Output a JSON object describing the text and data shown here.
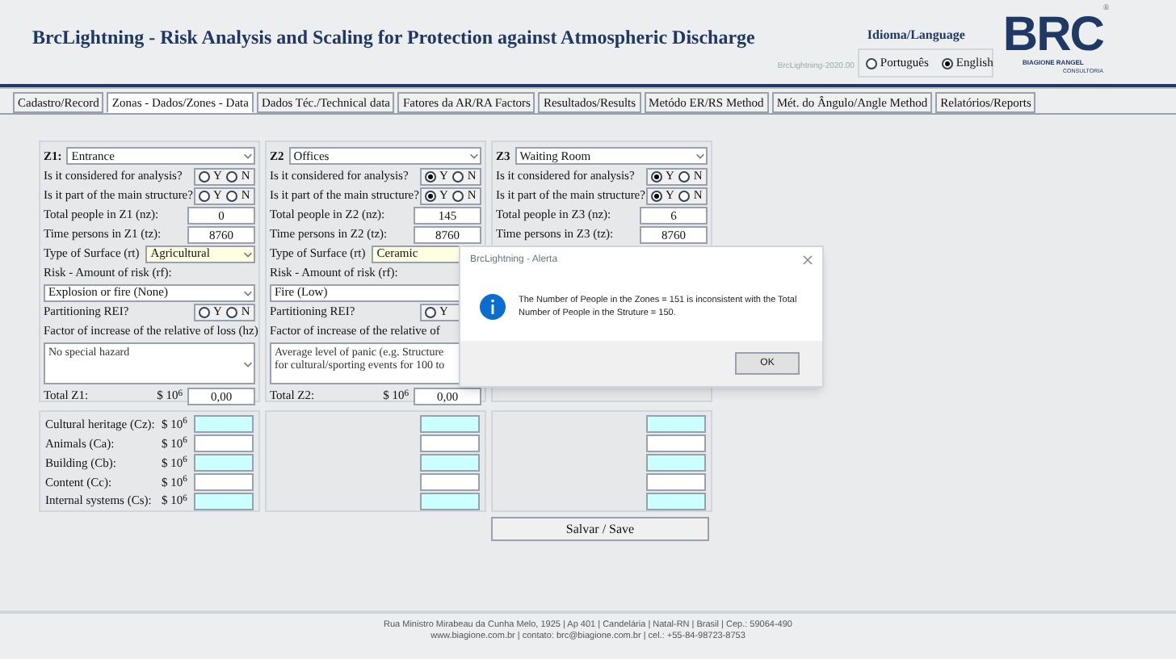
{
  "header": {
    "title": "BrcLightning - Risk Analysis and Scaling for Protection against Atmospheric Discharge",
    "version": "BrcLightning-2020.00",
    "language": {
      "label": "Idioma/Language",
      "options": [
        {
          "label": "Português",
          "selected": false
        },
        {
          "label": "English",
          "selected": true
        }
      ]
    },
    "logo": {
      "letters": "BRC",
      "name": "BIAGIONE RANGEL",
      "sub": "CONSULTORIA",
      "mark": "®"
    }
  },
  "tabs": [
    {
      "label": "Cadastro/Record",
      "selected": false
    },
    {
      "label": "Zonas - Dados/Zones - Data",
      "selected": true
    },
    {
      "label": "Dados Téc./Technical data",
      "selected": false
    },
    {
      "label": "Fatores da AR/RA Factors",
      "selected": false
    },
    {
      "label": "Resultados/Results",
      "selected": false
    },
    {
      "label": "Metódo ER/RS Method",
      "selected": false
    },
    {
      "label": "Mét. do Ângulo/Angle Method",
      "selected": false
    },
    {
      "label": "Relatórios/Reports",
      "selected": false
    }
  ],
  "zones": [
    {
      "code": "Z1:",
      "name": "Entrance",
      "rows": [
        {
          "kind": "yn",
          "label": "Is it considered for analysis?",
          "options": [
            {
              "label": "Y",
              "selected": false
            },
            {
              "label": "N",
              "selected": false
            }
          ]
        },
        {
          "kind": "yn",
          "label": "Is it part of the main structure?",
          "options": [
            {
              "label": "Y",
              "selected": false
            },
            {
              "label": "N",
              "selected": false
            }
          ]
        },
        {
          "kind": "input",
          "label": "Total people in Z1 (nz):",
          "value": "0"
        },
        {
          "kind": "input",
          "label": "Time persons in Z1 (tz):",
          "value": "8760"
        },
        {
          "kind": "inline_select",
          "label": "Type of Surface (rt)",
          "value": "Agricultural"
        },
        {
          "kind": "heading",
          "label": "Risk - Amount of risk (rf):"
        },
        {
          "kind": "select",
          "value": "Explosion or fire (None)"
        },
        {
          "kind": "yn",
          "label": "Partitioning REI?",
          "options": [
            {
              "label": "Y",
              "selected": false
            },
            {
              "label": "N",
              "selected": false
            }
          ]
        },
        {
          "kind": "heading",
          "label": "Factor of increase of the relative of loss (hz)"
        },
        {
          "kind": "textarea",
          "value": "No special hazard"
        },
        {
          "kind": "total",
          "label": "Total Z1:",
          "unit": "$ 10$^{6}$",
          "value": "0,00"
        }
      ]
    },
    {
      "code": "Z2",
      "name": "Offices",
      "rows": [
        {
          "kind": "yn",
          "label": "Is it considered for analysis?",
          "options": [
            {
              "label": "Y",
              "selected": true
            },
            {
              "label": "N",
              "selected": false
            }
          ]
        },
        {
          "kind": "yn",
          "label": "Is it part of the main structure?",
          "options": [
            {
              "label": "Y",
              "selected": true
            },
            {
              "label": "N",
              "selected": false
            }
          ]
        },
        {
          "kind": "input",
          "label": "Total people in Z2 (nz):",
          "value": "145"
        },
        {
          "kind": "input",
          "label": "Time persons in Z2 (tz):",
          "value": "8760"
        },
        {
          "kind": "inline_select",
          "label": "Type of Surface (rt)",
          "value": "Ceramic",
          "arrow": false
        },
        {
          "kind": "heading",
          "label": "Risk - Amount of risk (rf):"
        },
        {
          "kind": "select",
          "value": "Fire (Low)",
          "arrow": false
        },
        {
          "kind": "yn",
          "label": "Partitioning REI?",
          "options": [
            {
              "label": "Y",
              "selected": false
            }
          ]
        },
        {
          "kind": "heading",
          "label": "Factor of increase of the relative of"
        },
        {
          "kind": "textarea",
          "value": "Average level of panic (e.g. Structure for cultural/sporting events for 100 to",
          "arrow": false
        },
        {
          "kind": "total",
          "label": "Total Z2:",
          "unit": "$ 10$^{6}$",
          "value": "0,00"
        }
      ]
    },
    {
      "code": "Z3",
      "name": "Waiting Room",
      "rows": [
        {
          "kind": "yn",
          "label": "Is it considered for analysis?",
          "options": [
            {
              "label": "Y",
              "selected": true
            },
            {
              "label": "N",
              "selected": false
            }
          ]
        },
        {
          "kind": "yn",
          "label": "Is it part of the main structure?",
          "options": [
            {
              "label": "Y",
              "selected": true
            },
            {
              "label": "N",
              "selected": false
            }
          ]
        },
        {
          "kind": "input",
          "label": "Total people in Z3 (nz):",
          "value": "6"
        },
        {
          "kind": "input",
          "label": "Time persons in Z3 (tz):",
          "value": "8760"
        }
      ]
    }
  ],
  "costs": [
    {
      "label": "Cultural heritage (Cz):",
      "unit": "$ 10$^{6}$",
      "color": "#ccffff"
    },
    {
      "label": "Animals (Ca):",
      "unit": "$ 10$^{6}$",
      "color": "#ffffff"
    },
    {
      "label": "Building (Cb):",
      "unit": "$ 10$^{6}$",
      "color": "#ccffff"
    },
    {
      "label": "Content (Cc):",
      "unit": "$ 10$^{6}$",
      "color": "#ffffff"
    },
    {
      "label": "Internal systems (Cs):",
      "unit": "$ 10$^{6}$",
      "color": "#ccffff"
    }
  ],
  "save_button": "Salvar / Save",
  "dialog": {
    "title": "BrcLightning - Alerta",
    "message": "The Number of People in the Zones = 151 is inconsistent with the Total Number of People in the Struture = 150.",
    "button": "OK"
  },
  "footer": [
    "Rua Ministro Mirabeau da Cunha Melo, 1925 | Ap 401 | Candelária | Natal-RN | Brasil | Cep.: 59064-490",
    "www.biagione.com.br | contato: brc@biagione.com.br | cel.: +55-84-98723-8753"
  ]
}
